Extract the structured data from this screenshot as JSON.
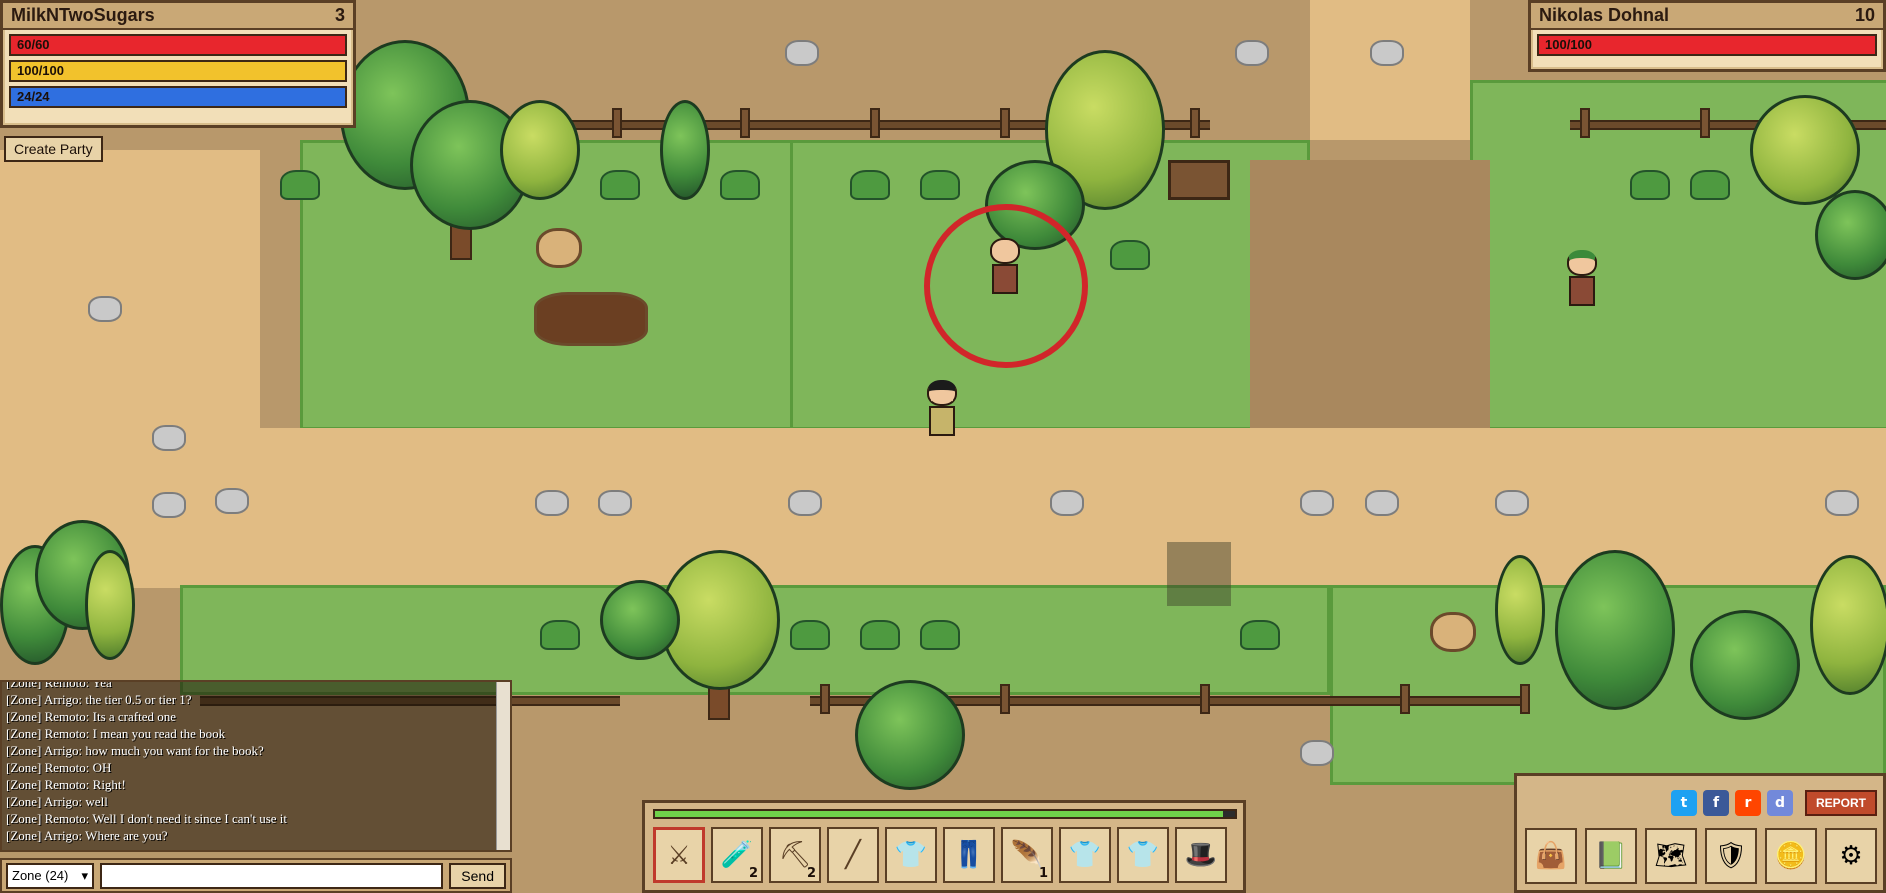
{
  "player": {
    "name": "MilkNTwoSugars",
    "level": "3",
    "health": "60/60",
    "stamina": "100/100",
    "mana": "24/24",
    "health_fraction": 1.0,
    "stamina_fraction": 1.0,
    "mana_fraction": 1.0
  },
  "target": {
    "name": "Nikolas Dohnal",
    "level": "10",
    "health": "100/100",
    "health_fraction": 1.0
  },
  "party": {
    "create_label": "Create Party"
  },
  "chat": {
    "lines": [
      "[Zone] Remoto: Yea",
      "[Zone] Arrigo: the tier 0.5 or tier 1?",
      "[Zone] Remoto: Its a crafted one",
      "[Zone] Remoto: I mean you read the book",
      "[Zone] Arrigo: how much you want for the book?",
      "[Zone] Remoto: OH",
      "[Zone] Remoto: Right!",
      "[Zone] Arrigo: well",
      "[Zone] Remoto: Well I don't need it since I can't use it",
      "[Zone] Arrigo: Where are you?"
    ],
    "channel": "Zone (24)",
    "send_label": "Send"
  },
  "hotbar": {
    "xp_fraction": 0.98,
    "slots": [
      {
        "icon": "sword-icon",
        "glyph": "⚔",
        "count": ""
      },
      {
        "icon": "health-potion-icon",
        "glyph": "🧪",
        "count": "2"
      },
      {
        "icon": "pickaxe-icon",
        "glyph": "⛏",
        "count": "2"
      },
      {
        "icon": "fishing-rod-icon",
        "glyph": "╱",
        "count": ""
      },
      {
        "icon": "blue-shirt-icon",
        "glyph": "👕",
        "count": ""
      },
      {
        "icon": "brown-pants-icon",
        "glyph": "👖",
        "count": ""
      },
      {
        "icon": "feather-icon",
        "glyph": "🪶",
        "count": "1"
      },
      {
        "icon": "tan-shirt-icon",
        "glyph": "👕",
        "count": ""
      },
      {
        "icon": "tan-shirt-icon",
        "glyph": "👕",
        "count": ""
      },
      {
        "icon": "hat-icon",
        "glyph": "🎩",
        "count": ""
      }
    ]
  },
  "menu": {
    "report_label": "REPORT",
    "social": [
      {
        "icon": "twitter-icon",
        "glyph": "t",
        "color": "#1da1f2"
      },
      {
        "icon": "facebook-icon",
        "glyph": "f",
        "color": "#3b5998"
      },
      {
        "icon": "reddit-icon",
        "glyph": "r",
        "color": "#ff4500"
      },
      {
        "icon": "discord-icon",
        "glyph": "d",
        "color": "#7289da"
      }
    ],
    "buttons": [
      {
        "icon": "inventory-bag-icon",
        "glyph": "👜"
      },
      {
        "icon": "skills-book-icon",
        "glyph": "📗"
      },
      {
        "icon": "world-map-icon",
        "glyph": "🗺"
      },
      {
        "icon": "character-icon",
        "glyph": "🛡"
      },
      {
        "icon": "gold-coins-icon",
        "glyph": "🪙"
      },
      {
        "icon": "settings-gear-icon",
        "glyph": "⚙"
      }
    ]
  },
  "colors": {
    "health": "#e8262d",
    "stamina": "#f2c22c",
    "mana": "#2f6fe0",
    "grass": "#7fb65a",
    "path": "#e1bc84"
  }
}
